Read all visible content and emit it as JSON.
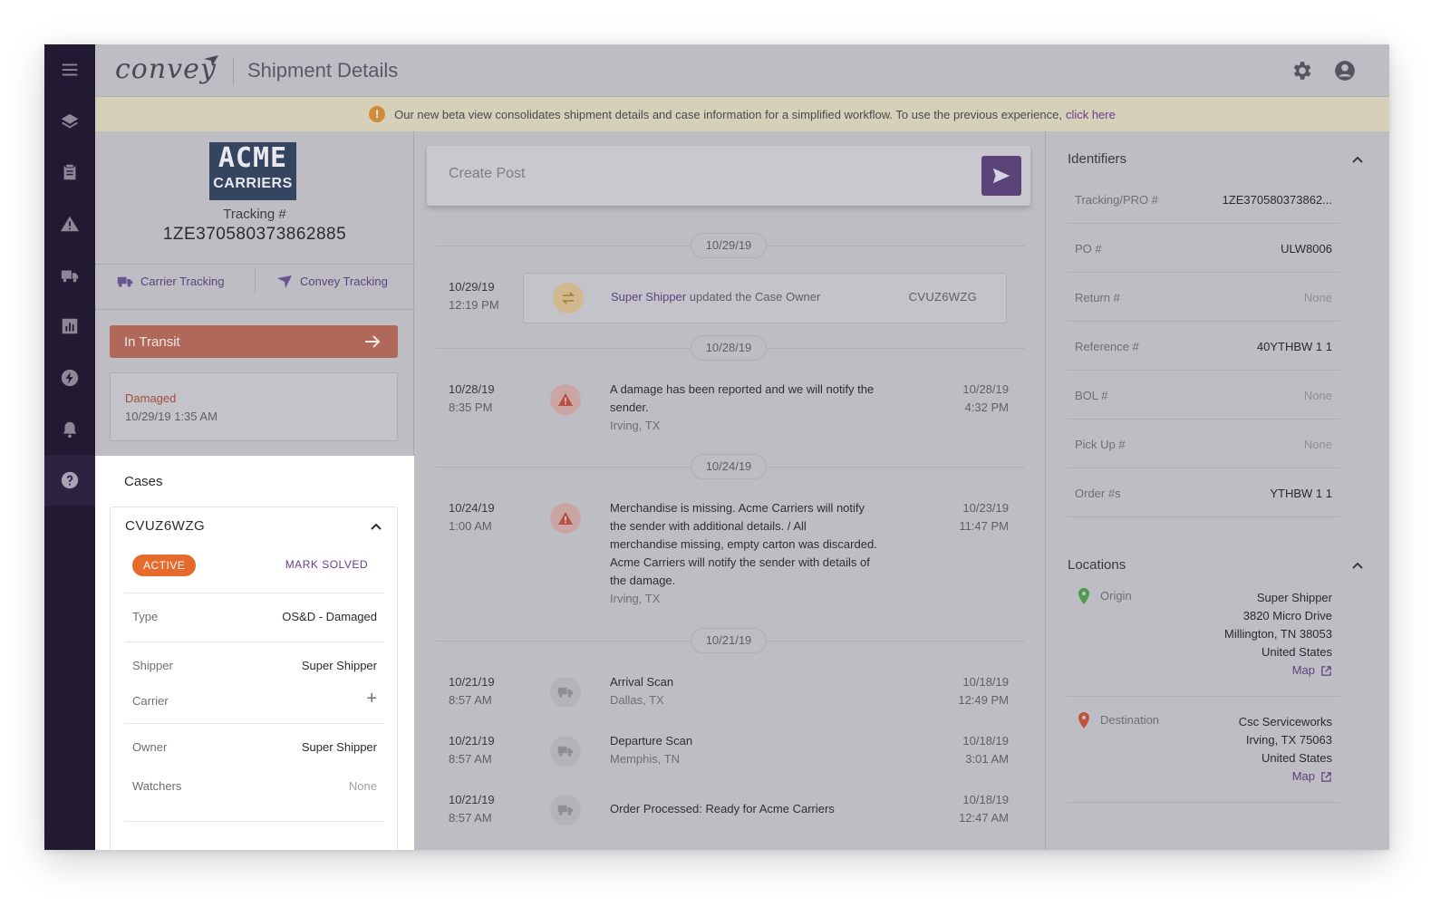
{
  "app": {
    "logo": "convey",
    "page_title": "Shipment Details"
  },
  "banner": {
    "text": "Our new beta view consolidates shipment details and case information for a simplified workflow. To use the previous experience,",
    "link": "click here",
    "icon": "!"
  },
  "rail": {
    "items": [
      "menu-icon",
      "layers-icon",
      "clipboard-icon",
      "alert-icon",
      "truck-icon",
      "chart-icon",
      "bolt-icon",
      "bell-icon",
      "help-icon"
    ]
  },
  "shipment": {
    "carrier_logo_line1": "ACME",
    "carrier_logo_line2": "CARRIERS",
    "tracking_label": "Tracking #",
    "tracking_number": "1ZE370580373862885",
    "carrier_tracking": "Carrier Tracking",
    "convey_tracking": "Convey Tracking",
    "status": "In Transit",
    "latest_event": {
      "title": "Damaged",
      "time": "10/29/19 1:35 AM"
    }
  },
  "cases": {
    "title": "Cases",
    "case": {
      "id": "CVUZ6WZG",
      "badge": "ACTIVE",
      "mark_solved": "MARK SOLVED",
      "rows": [
        {
          "key": "Type",
          "value": "OS&D - Damaged"
        },
        {
          "key": "Shipper",
          "value": "Super Shipper"
        },
        {
          "key": "Carrier",
          "value": "+"
        },
        {
          "key": "Owner",
          "value": "Super Shipper"
        },
        {
          "key": "Watchers",
          "value": "None"
        }
      ]
    }
  },
  "timeline": {
    "post_placeholder": "Create Post",
    "groups": [
      {
        "date": "10/29/19"
      },
      {
        "date": "10/28/19"
      },
      {
        "date": "10/24/19"
      },
      {
        "date": "10/21/19"
      }
    ],
    "update": {
      "date": "10/29/19",
      "time": "12:19 PM",
      "who": "Super Shipper",
      "text": "updated the Case Owner",
      "code": "CVUZ6WZG"
    },
    "events": [
      {
        "date": "10/28/19",
        "time": "8:35 PM",
        "line1": "A damage has been reported and we will notify the",
        "line2": "sender.",
        "loc": "Irving, TX",
        "rdate": "10/28/19",
        "rtime": "4:32 PM"
      },
      {
        "date": "10/24/19",
        "time": "1:00 AM",
        "line1": "Merchandise is missing. Acme Carriers will notify",
        "line2": "the sender with additional details. / All",
        "line3": "merchandise missing, empty carton was discarded.",
        "line4": "Acme Carriers will notify the sender with details of",
        "line5": "the damage.",
        "loc": "Irving, TX",
        "rdate": "10/23/19",
        "rtime": "11:47 PM"
      },
      {
        "date": "10/21/19",
        "time": "8:57 AM",
        "line1": "Arrival Scan",
        "loc": "Dallas, TX",
        "rdate": "10/18/19",
        "rtime": "12:49 PM"
      },
      {
        "date": "10/21/19",
        "time": "8:57 AM",
        "line1": "Departure Scan",
        "loc": "Memphis, TN",
        "rdate": "10/18/19",
        "rtime": "3:01 AM"
      },
      {
        "date": "10/21/19",
        "time": "8:57 AM",
        "line1": "Order Processed: Ready for Acme Carriers",
        "rdate": "10/18/19",
        "rtime": "12:47 AM"
      }
    ]
  },
  "identifiers": {
    "title": "Identifiers",
    "rows": [
      {
        "key": "Tracking/PRO #",
        "value": "1ZE370580373862..."
      },
      {
        "key": "PO #",
        "value": "ULW8006"
      },
      {
        "key": "Return #",
        "value": "None"
      },
      {
        "key": "Reference #",
        "value": "40YTHBW 1 1"
      },
      {
        "key": "BOL #",
        "value": "None"
      },
      {
        "key": "Pick Up #",
        "value": "None"
      },
      {
        "key": "Order #s",
        "value": "YTHBW 1 1"
      }
    ]
  },
  "locations": {
    "title": "Locations",
    "origin": {
      "label": "Origin",
      "name": "Super Shipper",
      "street": "3820 Micro Drive",
      "city": "Millington, TN 38053",
      "country": "United States",
      "map": "Map"
    },
    "destination": {
      "label": "Destination",
      "name": "Csc Serviceworks",
      "city": "Irving, TX 75063",
      "country": "United States",
      "map": "Map"
    }
  },
  "colors": {
    "rail": "#221a33",
    "accent": "#5b4477",
    "status": "#b0685a",
    "badge": "#e56a2c",
    "origin_pin": "#4f9a4f",
    "destination_pin": "#c2513e"
  }
}
